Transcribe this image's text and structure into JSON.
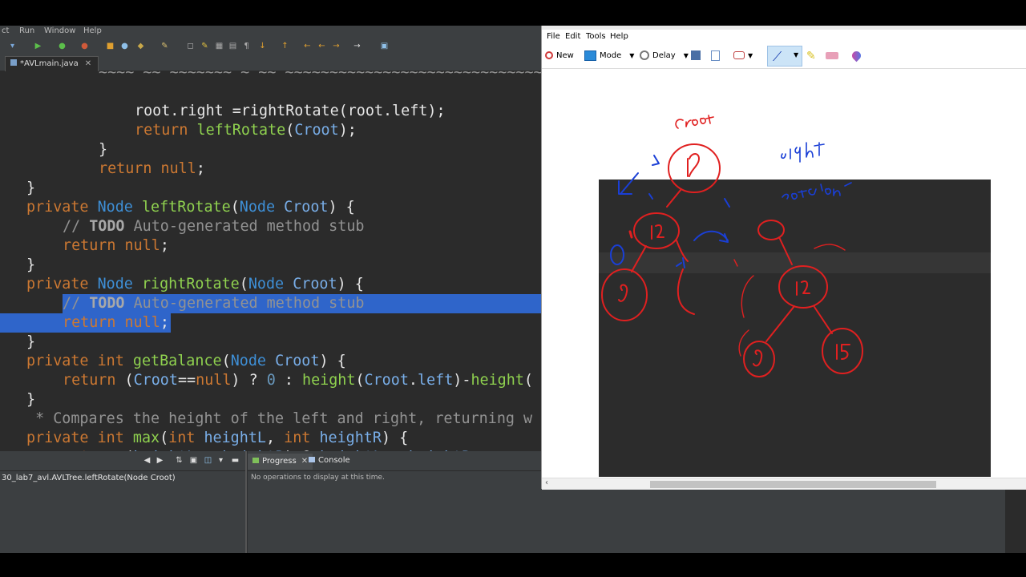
{
  "ide": {
    "menu": [
      "ct",
      "Run",
      "Window",
      "Help"
    ],
    "tab": {
      "title": "*AVLmain.java",
      "close": "✕"
    },
    "code_lines": [
      {
        "indent": 3,
        "parts": [
          [
            "tx",
            "root.right =rightRotate(root.left);"
          ]
        ]
      },
      {
        "indent": 3,
        "parts": [
          [
            "kw",
            "return "
          ],
          [
            "fn",
            "leftRotate"
          ],
          [
            "tx",
            "("
          ],
          [
            "vr",
            "Croot"
          ],
          [
            "tx",
            ");"
          ]
        ]
      },
      {
        "indent": 2,
        "parts": [
          [
            "tx",
            "}"
          ]
        ]
      },
      {
        "indent": 2,
        "parts": [
          [
            "kw",
            "return "
          ],
          [
            "kw",
            "null"
          ],
          [
            "tx",
            ";"
          ]
        ]
      },
      {
        "indent": 0,
        "parts": [
          [
            "tx",
            "}"
          ]
        ]
      },
      {
        "indent": 0,
        "parts": [
          [
            "kw",
            "private "
          ],
          [
            "ty",
            "Node "
          ],
          [
            "fn",
            "leftRotate"
          ],
          [
            "tx",
            "("
          ],
          [
            "ty",
            "Node "
          ],
          [
            "vr",
            "Croot"
          ],
          [
            "tx",
            ") {"
          ]
        ]
      },
      {
        "indent": 1,
        "parts": [
          [
            "cm",
            "// "
          ],
          [
            "cmb",
            "TODO"
          ],
          [
            "cm",
            " Auto-generated method stub"
          ]
        ]
      },
      {
        "indent": 1,
        "parts": [
          [
            "kw",
            "return "
          ],
          [
            "kw",
            "null"
          ],
          [
            "tx",
            ";"
          ]
        ]
      },
      {
        "indent": 0,
        "parts": [
          [
            "tx",
            "}"
          ]
        ]
      },
      {
        "indent": 0,
        "parts": [
          [
            "kw",
            "private "
          ],
          [
            "ty",
            "Node "
          ],
          [
            "fn",
            "rightRotate"
          ],
          [
            "tx",
            "("
          ],
          [
            "ty",
            "Node "
          ],
          [
            "vr",
            "Croot"
          ],
          [
            "tx",
            ") {"
          ]
        ]
      },
      {
        "indent": 1,
        "parts": [
          [
            "cm",
            "// "
          ],
          [
            "cmb",
            "TODO"
          ],
          [
            "cm",
            " Auto-generated method stub"
          ]
        ]
      },
      {
        "indent": 1,
        "parts": [
          [
            "kw",
            "return "
          ],
          [
            "kw",
            "null"
          ],
          [
            "tx",
            ";"
          ]
        ]
      },
      {
        "indent": 0,
        "parts": [
          [
            "tx",
            "}"
          ]
        ]
      },
      {
        "indent": 0,
        "parts": [
          [
            "kw",
            "private int "
          ],
          [
            "fn",
            "getBalance"
          ],
          [
            "tx",
            "("
          ],
          [
            "ty",
            "Node "
          ],
          [
            "vr",
            "Croot"
          ],
          [
            "tx",
            ") {"
          ]
        ]
      },
      {
        "indent": 1,
        "parts": [
          [
            "kw",
            "return "
          ],
          [
            "tx",
            "("
          ],
          [
            "vr",
            "Croot"
          ],
          [
            "tx",
            "=="
          ],
          [
            "kw",
            "null"
          ],
          [
            "tx",
            ") ? "
          ],
          [
            "nu",
            "0"
          ],
          [
            "tx",
            " : "
          ],
          [
            "fn",
            "height"
          ],
          [
            "tx",
            "("
          ],
          [
            "vr",
            "Croot"
          ],
          [
            "tx",
            "."
          ],
          [
            "vr",
            "left"
          ],
          [
            "tx",
            ")-"
          ],
          [
            "fn",
            "height"
          ],
          [
            "tx",
            "("
          ]
        ]
      },
      {
        "indent": 0,
        "parts": [
          [
            "tx",
            "}"
          ]
        ]
      },
      {
        "indent": 0,
        "parts": [
          [
            "cm",
            " * Compares the height of the left and right, returning w"
          ]
        ]
      },
      {
        "indent": 0,
        "parts": [
          [
            "kw",
            "private int "
          ],
          [
            "fn",
            "max"
          ],
          [
            "tx",
            "("
          ],
          [
            "kw",
            "int "
          ],
          [
            "vr",
            "heightL"
          ],
          [
            "tx",
            ", "
          ],
          [
            "kw",
            "int "
          ],
          [
            "vr",
            "heightR"
          ],
          [
            "tx",
            ") {"
          ]
        ]
      },
      {
        "indent": 1,
        "parts": [
          [
            "kw",
            "return "
          ],
          [
            "tx",
            "("
          ],
          [
            "vr",
            "heightL"
          ],
          [
            "tx",
            " > "
          ],
          [
            "vr",
            "heightR"
          ],
          [
            "tx",
            ") ? "
          ],
          [
            "vr",
            "heightL"
          ],
          [
            "tx",
            " : "
          ],
          [
            "vr",
            "heightR"
          ],
          [
            "tx",
            ";"
          ]
        ]
      }
    ],
    "selected_lines": [
      10,
      11
    ],
    "bottom_left_item": "30_lab7_avl.AVLTree.leftRotate(Node Croot)",
    "bottom_tabs": {
      "progress": "Progress",
      "console": "Console"
    },
    "progress_empty": "No operations to display at this time."
  },
  "snip": {
    "menu": [
      "File",
      "Edit",
      "Tools",
      "Help"
    ],
    "toolbar": {
      "new": "New",
      "mode": "Mode",
      "delay": "Delay"
    },
    "ink_color": "#e02020",
    "ink_blue": "#1a3fd6"
  }
}
